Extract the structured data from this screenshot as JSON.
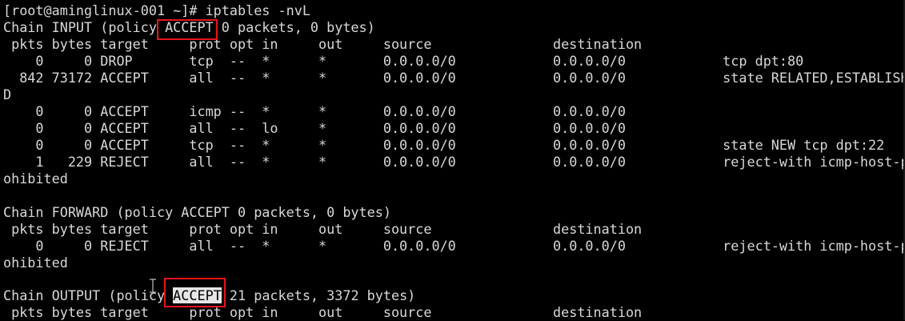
{
  "terminal": {
    "lines": [
      "[root@aminglinux-001 ~]# iptables -nvL",
      "Chain INPUT (policy ACCEPT 0 packets, 0 bytes)",
      " pkts bytes target     prot opt in     out     source               destination",
      "    0     0 DROP       tcp  --  *      *       0.0.0.0/0            0.0.0.0/0            tcp dpt:80",
      "  842 73172 ACCEPT     all  --  *      *       0.0.0.0/0            0.0.0.0/0            state RELATED,ESTABLISHE",
      "D",
      "    0     0 ACCEPT     icmp --  *      *       0.0.0.0/0            0.0.0.0/0",
      "    0     0 ACCEPT     all  --  lo     *       0.0.0.0/0            0.0.0.0/0",
      "    0     0 ACCEPT     tcp  --  *      *       0.0.0.0/0            0.0.0.0/0            state NEW tcp dpt:22",
      "    1   229 REJECT     all  --  *      *       0.0.0.0/0            0.0.0.0/0            reject-with icmp-host-pr",
      "ohibited",
      "",
      "Chain FORWARD (policy ACCEPT 0 packets, 0 bytes)",
      " pkts bytes target     prot opt in     out     source               destination",
      "    0     0 REJECT     all  --  *      *       0.0.0.0/0            0.0.0.0/0            reject-with icmp-host-pr",
      "ohibited",
      "",
      "Chain OUTPUT (policy ",
      " pkts bytes target     prot opt in     out     source               destination"
    ],
    "output_policy_word": "ACCEPT",
    "output_policy_rest": " 21 packets, 3372 bytes)"
  },
  "colors": {
    "background": "#000000",
    "text": "#d8d8d8",
    "highlight_box": "#e8141c",
    "selection_bg": "#e6e6e6"
  },
  "icons": {
    "cursor": "text-cursor-ibeam-icon"
  }
}
